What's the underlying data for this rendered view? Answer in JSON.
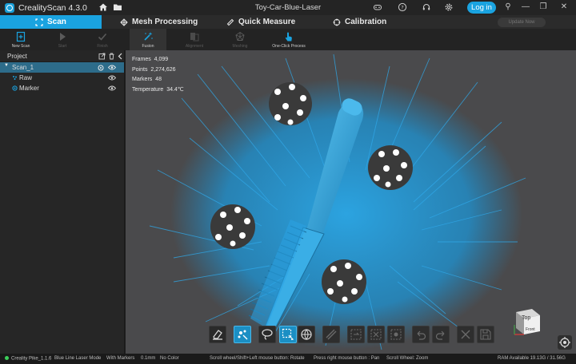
{
  "app": {
    "name": "CrealityScan 4.3.0",
    "document_title": "Toy-Car-Blue-Laser",
    "login_label": "Log in",
    "update_label": "Update Now",
    "accent": "#1aa3e0"
  },
  "tabs": [
    {
      "label": "Scan",
      "icon": "scan-icon",
      "active": true
    },
    {
      "label": "Mesh Processing",
      "icon": "mesh-icon",
      "active": false
    },
    {
      "label": "Quick Measure",
      "icon": "ruler-icon",
      "active": false
    },
    {
      "label": "Calibration",
      "icon": "crosshair-icon",
      "active": false
    }
  ],
  "toolbar": {
    "new_scan": "New Scan",
    "start": "Start",
    "finish": "Finish",
    "fusion": "Fusion",
    "alignment": "Alignment",
    "meshing": "Meshing",
    "one_click": "One-Click Process"
  },
  "project": {
    "header": "Project",
    "scan_name": "Scan_1",
    "raw_label": "Raw",
    "marker_label": "Marker"
  },
  "stats": {
    "frames_label": "Frames",
    "frames_value": "4,099",
    "points_label": "Points",
    "points_value": "2,274,626",
    "markers_label": "Markers",
    "markers_value": "48",
    "temperature_label": "Temperature",
    "temperature_value": "34.4℃"
  },
  "view_cube": {
    "top": "Top",
    "front": "Front"
  },
  "status": {
    "device": "Creality Pike_1.1.6",
    "mode": "Blue Line Laser Mode",
    "markers": "With Markers",
    "resolution": "0.1mm",
    "color": "No Color",
    "hint1": "Scroll wheel/Shift+Left mouse button: Rotate",
    "hint2": "Press right mouse button : Pan",
    "hint3": "Scroll Wheel: Zoom",
    "ram": "RAM Available 19.13G / 31.56G",
    "device_status_color": "#3ccf5a"
  }
}
